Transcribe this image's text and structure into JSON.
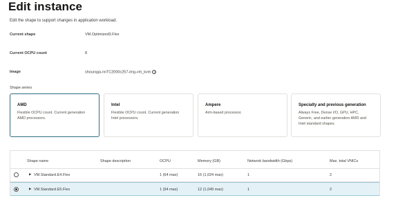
{
  "title": "Edit instance",
  "subtitle": "Edit the shape to support changes in application workload.",
  "details": {
    "current_shape_label": "Current shape",
    "current_shape_value": "VM.Optimized3.Flex",
    "current_ocpu_label": "Current OCPU count",
    "current_ocpu_value": "8",
    "image_label": "Image",
    "image_value": "shouraga-nnTC2000c257-img-vm_kvm",
    "image_info_icon": "info-icon"
  },
  "shape_series": {
    "label": "Shape series",
    "cards": [
      {
        "title": "AMD",
        "desc": "Flexible OCPU count. Current generation AMD processors.",
        "selected": true
      },
      {
        "title": "Intel",
        "desc": "Flexible OCPU count. Current generation Intel processors.",
        "selected": false
      },
      {
        "title": "Ampere",
        "desc": "Arm-based processor.",
        "selected": false
      },
      {
        "title": "Specialty and previous generation",
        "desc": "Always Free, Dense I/O, GPU, HPC, Generic, and earlier generation AMD and Intel standard shapes.",
        "selected": false
      }
    ]
  },
  "table": {
    "headers": {
      "shape_name": "Shape name",
      "shape_description": "Shape description",
      "ocpu": "OCPU",
      "memory": "Memory (GB)",
      "network": "Network bandwidth (Gbps)",
      "vnics": "Max. total VNICs"
    },
    "rows": [
      {
        "name": "VM.Standard.E4.Flex",
        "description": "",
        "ocpu": "1 (64 max)",
        "memory": "16 (1,024 max)",
        "network": "1",
        "vnics": "2",
        "selected": false
      },
      {
        "name": "VM.Standard.E5.Flex",
        "description": "",
        "ocpu": "1 (94 max)",
        "memory": "12 (1,049 max)",
        "network": "1",
        "vnics": "2",
        "selected": true
      }
    ]
  },
  "colors": {
    "selected_border": "#2f6f7e",
    "selected_row_bg": "#e4f1f7"
  }
}
